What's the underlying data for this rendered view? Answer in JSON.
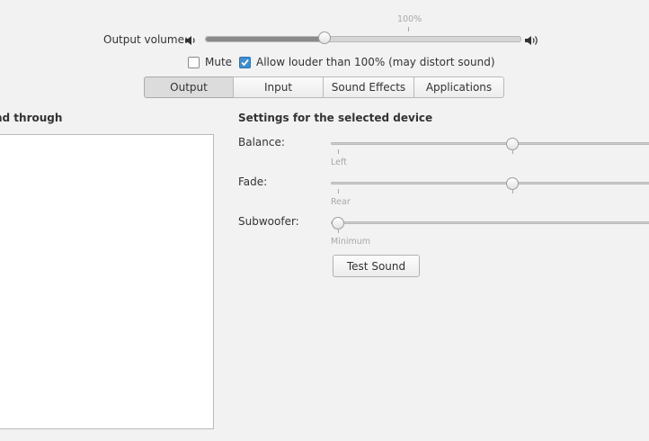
{
  "volume": {
    "label": "Output volume:",
    "max_marker": "100%",
    "level_fraction": 0.38,
    "low_icon": "speaker-low-icon",
    "high_icon": "speaker-high-icon"
  },
  "options": {
    "mute_label": "Mute",
    "mute_checked": false,
    "allow_louder_label": "Allow louder than 100% (may distort sound)",
    "allow_louder_checked": true
  },
  "tabs": [
    {
      "label": "Output",
      "active": true
    },
    {
      "label": "Input",
      "active": false
    },
    {
      "label": "Sound Effects",
      "active": false
    },
    {
      "label": "Applications",
      "active": false
    }
  ],
  "left_panel": {
    "heading": "nd through"
  },
  "settings": {
    "heading": "Settings for the selected device",
    "balance": {
      "label": "Balance:",
      "left_mark": "Left",
      "position_fraction": 0.5
    },
    "fade": {
      "label": "Fade:",
      "left_mark": "Rear",
      "position_fraction": 0.5
    },
    "subwoofer": {
      "label": "Subwoofer:",
      "left_mark": "Minimum",
      "position_fraction": 0.0
    },
    "test_button": "Test Sound"
  },
  "colors": {
    "accent": "#3d8fd1",
    "background": "#f2f2f2"
  }
}
